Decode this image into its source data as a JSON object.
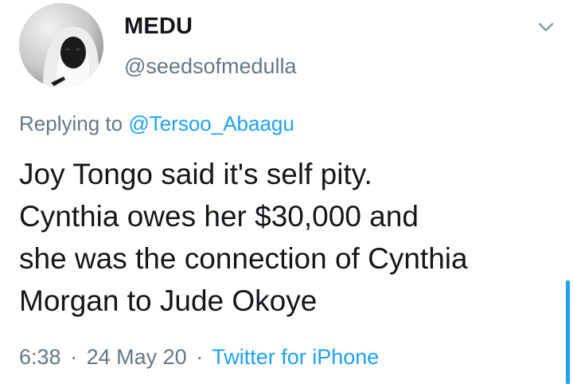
{
  "user": {
    "display_name": "MEDU",
    "handle": "@seedsofmedulla"
  },
  "reply": {
    "prefix": "Replying to",
    "mention": "@Tersoo_Abaagu"
  },
  "tweet": {
    "text": "Joy Tongo said it's self pity.\nCynthia owes her $30,000 and\nshe was the connection of Cynthia\nMorgan to Jude Okoye"
  },
  "meta": {
    "time": "6:38",
    "separator": "·",
    "date": "24 May 20",
    "source": "Twitter for iPhone"
  },
  "icons": {
    "menu": "chevron-down-icon"
  },
  "colors": {
    "link": "#1da1f2",
    "secondary_text": "#657786",
    "primary_text": "#14171a"
  }
}
